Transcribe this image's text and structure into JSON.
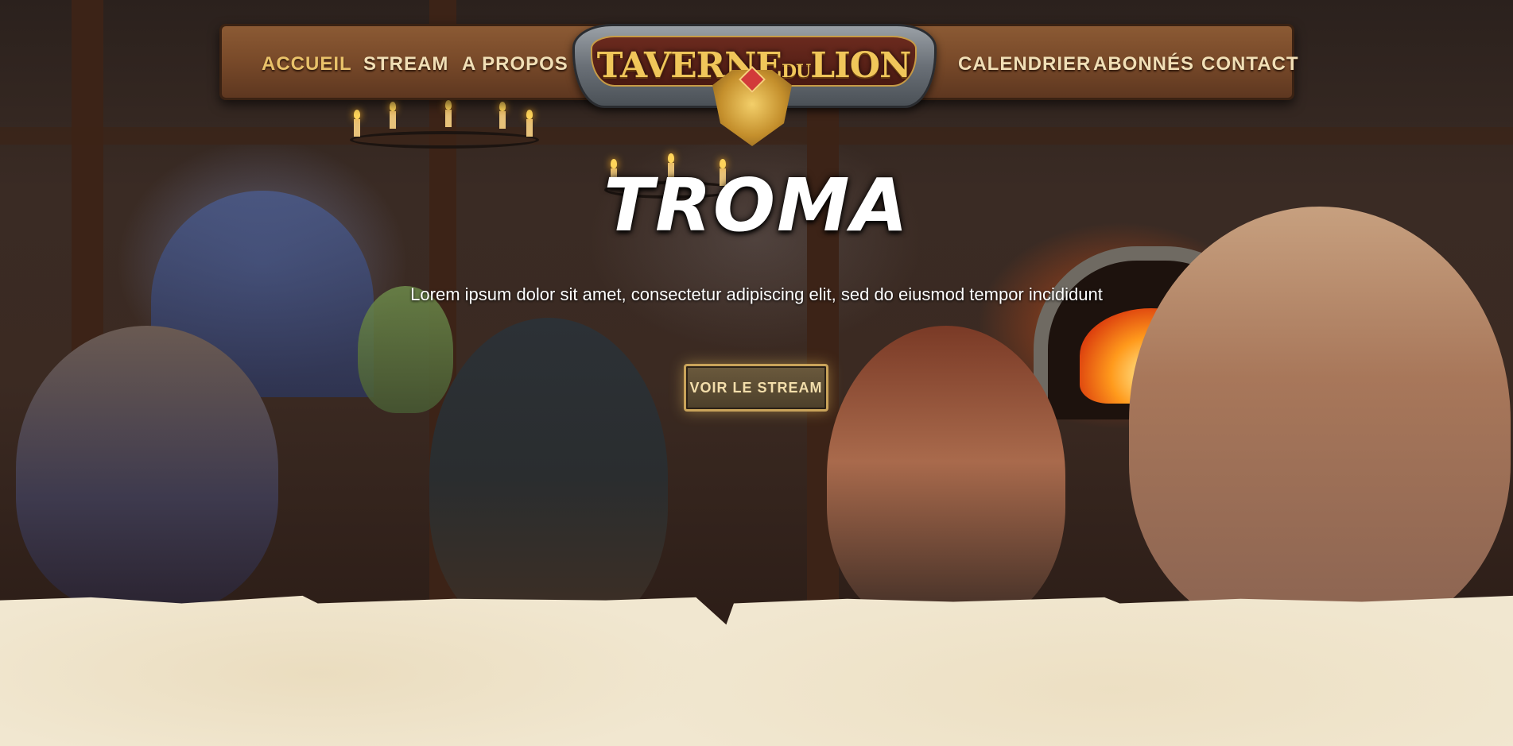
{
  "nav": {
    "left": [
      {
        "label": "ACCUEIL"
      },
      {
        "label": "STREAM"
      },
      {
        "label": "A PROPOS"
      }
    ],
    "right": [
      {
        "label": "CALENDRIER"
      },
      {
        "label": "ABONNÉS"
      },
      {
        "label": "CONTACT"
      }
    ]
  },
  "logo": {
    "part1": "TAVERNE",
    "part2": "DU",
    "part3": "LION"
  },
  "hero": {
    "title": "TROMA",
    "text": "Lorem ipsum dolor sit amet, consectetur adipiscing elit, sed do eiusmod tempor incididunt",
    "cta_label": "VOIR LE STREAM"
  },
  "colors": {
    "nav_wood": "#7a4b2a",
    "nav_text": "#f1dfb6",
    "nav_active": "#e9c26a",
    "logo_gold": "#f0c65a",
    "parchment": "#f1e7d0",
    "cta_border": "#c9a35a"
  }
}
